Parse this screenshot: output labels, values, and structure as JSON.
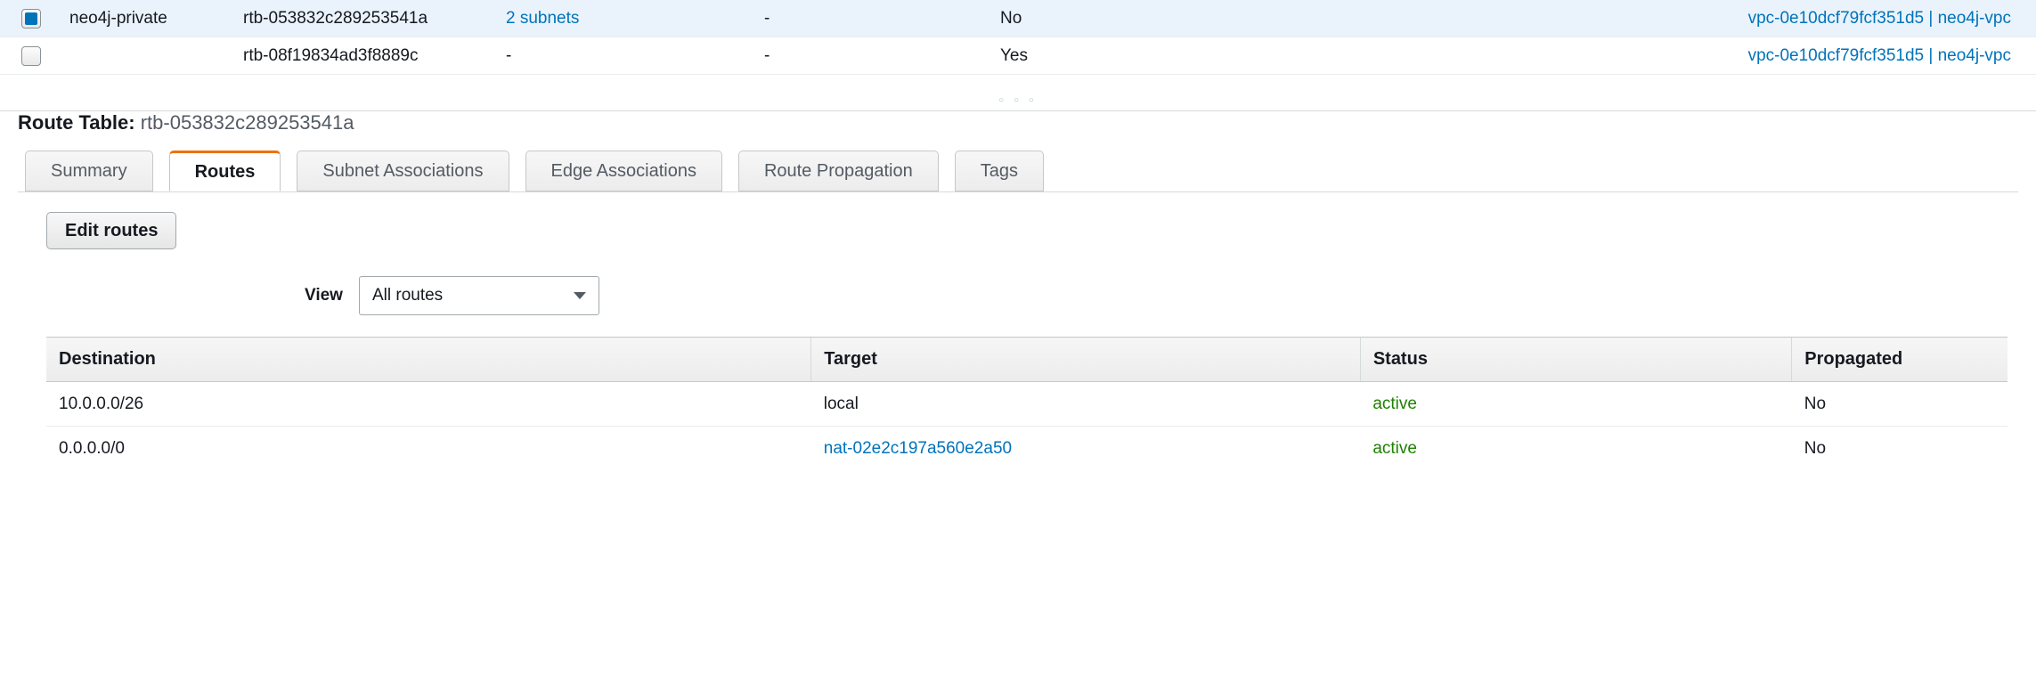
{
  "route_tables": [
    {
      "selected": true,
      "name": "neo4j-private",
      "id": "rtb-053832c289253541a",
      "assoc": "2 subnets",
      "assoc_link": true,
      "edge": "-",
      "main": "No",
      "vpc": "vpc-0e10dcf79fcf351d5 | neo4j-vpc"
    },
    {
      "selected": false,
      "name": "",
      "id": "rtb-08f19834ad3f8889c",
      "assoc": "-",
      "assoc_link": false,
      "edge": "-",
      "main": "Yes",
      "vpc": "vpc-0e10dcf79fcf351d5 | neo4j-vpc"
    }
  ],
  "details_label": "Route Table:",
  "details_value": "rtb-053832c289253541a",
  "tabs": {
    "summary": "Summary",
    "routes": "Routes",
    "subnet_assoc": "Subnet Associations",
    "edge_assoc": "Edge Associations",
    "route_prop": "Route Propagation",
    "tags": "Tags"
  },
  "active_tab": "routes",
  "edit_routes_label": "Edit routes",
  "view_label": "View",
  "view_selected": "All routes",
  "routes_columns": {
    "dest": "Destination",
    "target": "Target",
    "status": "Status",
    "propagated": "Propagated"
  },
  "routes": [
    {
      "dest": "10.0.0.0/26",
      "target": "local",
      "target_link": false,
      "status": "active",
      "propagated": "No"
    },
    {
      "dest": "0.0.0.0/0",
      "target": "nat-02e2c197a560e2a50",
      "target_link": true,
      "status": "active",
      "propagated": "No"
    }
  ]
}
